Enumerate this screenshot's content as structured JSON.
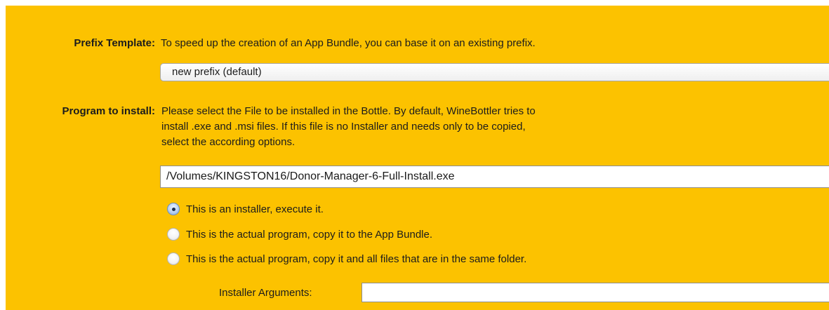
{
  "prefix_template": {
    "label": "Prefix Template:",
    "description": "To speed up the creation of an App Bundle, you can base it on an existing prefix.",
    "selected_value": "new prefix (default)"
  },
  "program_to_install": {
    "label": "Program to install:",
    "description_lines": [
      "Please select the File to be installed in the Bottle. By default, WineBottler tries to",
      "install .exe and .msi files. If this file is no Installer and needs only to be copied,",
      "select the according options."
    ],
    "file_path": "/Volumes/KINGSTON16/Donor-Manager-6-Full-Install.exe",
    "options": [
      {
        "label": "This is an installer, execute it.",
        "selected": true
      },
      {
        "label": "This is the actual program, copy it to the App Bundle.",
        "selected": false
      },
      {
        "label": "This is the actual program, copy it and all files that are in the same folder.",
        "selected": false
      }
    ]
  },
  "installer_arguments": {
    "label": "Installer Arguments:",
    "value": ""
  },
  "colors": {
    "panel_background": "#fcc200",
    "radio_selected": "#7fa6dc"
  }
}
